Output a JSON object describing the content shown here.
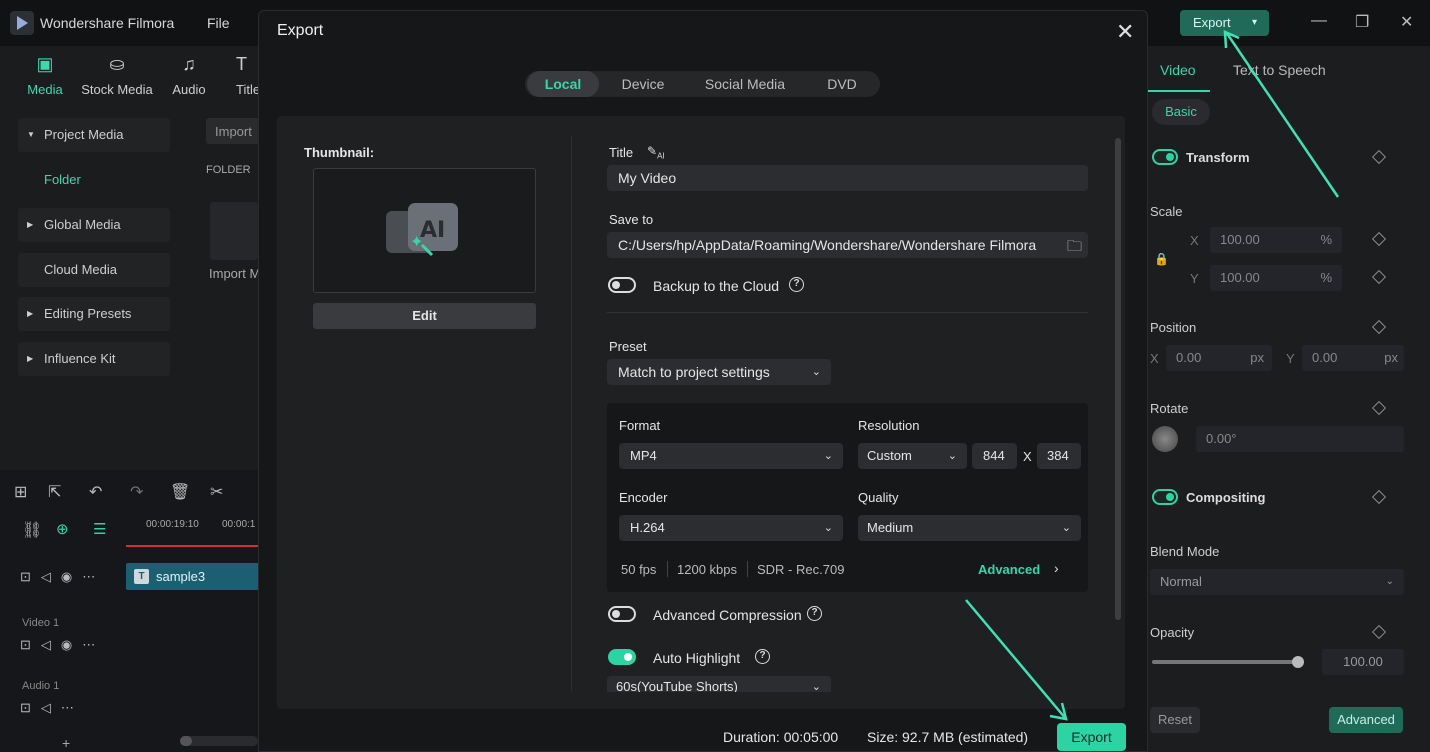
{
  "app": {
    "title": "Wondershare Filmora",
    "menu_file": "File",
    "export_label": "Export"
  },
  "toolbar": {
    "items": [
      {
        "label": "Media",
        "icon": "media-icon"
      },
      {
        "label": "Stock Media",
        "icon": "stock-media-icon"
      },
      {
        "label": "Audio",
        "icon": "audio-icon"
      },
      {
        "label": "Title",
        "icon": "title-icon"
      }
    ]
  },
  "left_panel": {
    "items": [
      "Project Media",
      "Folder",
      "Global Media",
      "Cloud Media",
      "Editing Presets",
      "Influence Kit"
    ],
    "import_label": "Import",
    "folder_header": "FOLDER",
    "import_media": "Import M"
  },
  "timeline": {
    "time1": "00:00:19:10",
    "time2": "00:00:1",
    "clip": "sample3",
    "video_track": "Video 1",
    "audio_track": "Audio 1"
  },
  "right_panel": {
    "tabs": [
      "Video",
      "Text to Speech"
    ],
    "basic": "Basic",
    "transform": "Transform",
    "scale": "Scale",
    "x": "X",
    "y": "Y",
    "scale_x": "100.00",
    "scale_y": "100.00",
    "pct": "%",
    "position": "Position",
    "pos_x": "0.00",
    "pos_y": "0.00",
    "px": "px",
    "rotate": "Rotate",
    "rotate_val": "0.00°",
    "compositing": "Compositing",
    "blend_mode": "Blend Mode",
    "blend_val": "Normal",
    "opacity": "Opacity",
    "opacity_val": "100.00",
    "opacity_fraction": 1.0,
    "reset": "Reset",
    "advanced": "Advanced"
  },
  "modal": {
    "title": "Export",
    "tabs": [
      "Local",
      "Device",
      "Social Media",
      "DVD"
    ],
    "thumbnail_label": "Thumbnail:",
    "edit_label": "Edit",
    "title_label": "Title",
    "title_value": "My Video",
    "save_to_label": "Save to",
    "save_to_value": "C:/Users/hp/AppData/Roaming/Wondershare/Wondershare Filmora",
    "backup_label": "Backup to the Cloud",
    "preset_label": "Preset",
    "preset_value": "Match to project settings",
    "format_label": "Format",
    "format_value": "MP4",
    "resolution_label": "Resolution",
    "resolution_value": "Custom",
    "res_w": "844",
    "res_x": "X",
    "res_h": "384",
    "encoder_label": "Encoder",
    "encoder_value": "H.264",
    "quality_label": "Quality",
    "quality_value": "Medium",
    "fps": "50 fps",
    "bitrate": "1200 kbps",
    "color": "SDR - Rec.709",
    "advanced_label": "Advanced",
    "adv_compression_label": "Advanced Compression",
    "auto_highlight_label": "Auto Highlight",
    "highlight_value": "60s(YouTube Shorts)",
    "duration": "Duration: 00:05:00",
    "size": "Size:  92.7 MB (estimated)",
    "export_button": "Export"
  },
  "colors": {
    "accent": "#2dd4a3",
    "dark_bg": "#161719"
  }
}
